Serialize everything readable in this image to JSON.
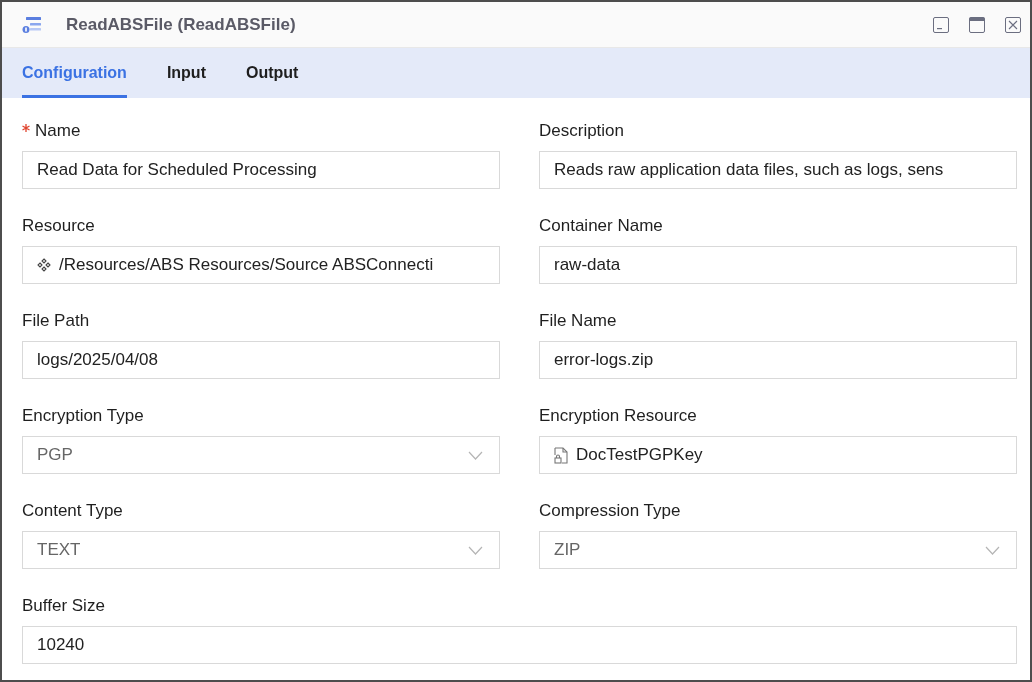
{
  "window": {
    "title": "ReadABSFile (ReadABSFile)"
  },
  "tabs": [
    {
      "label": "Configuration",
      "selected": true
    },
    {
      "label": "Input",
      "selected": false
    },
    {
      "label": "Output",
      "selected": false
    }
  ],
  "form": {
    "rows": [
      [
        {
          "label": "Name",
          "required": true,
          "kind": "text",
          "value": "Read Data for Scheduled Processing"
        },
        {
          "label": "Description",
          "required": false,
          "kind": "text",
          "value": "Reads raw application data files, such as logs, sens"
        }
      ],
      [
        {
          "label": "Resource",
          "required": false,
          "kind": "resource",
          "value": "/Resources/ABS Resources/Source ABSConnecti"
        },
        {
          "label": "Container Name",
          "required": false,
          "kind": "text",
          "value": "raw-data"
        }
      ],
      [
        {
          "label": "File Path",
          "required": false,
          "kind": "text",
          "value": "logs/2025/04/08"
        },
        {
          "label": "File Name",
          "required": false,
          "kind": "text",
          "value": "error-logs.zip"
        }
      ],
      [
        {
          "label": "Encryption Type",
          "required": false,
          "kind": "select",
          "value": "PGP"
        },
        {
          "label": "Encryption Resource",
          "required": false,
          "kind": "keyfile",
          "value": "DocTestPGPKey"
        }
      ],
      [
        {
          "label": "Content Type",
          "required": false,
          "kind": "select",
          "value": "TEXT"
        },
        {
          "label": "Compression Type",
          "required": false,
          "kind": "select",
          "value": "ZIP"
        }
      ],
      [
        {
          "label": "Buffer Size",
          "required": false,
          "kind": "text",
          "value": "10240"
        }
      ]
    ]
  }
}
